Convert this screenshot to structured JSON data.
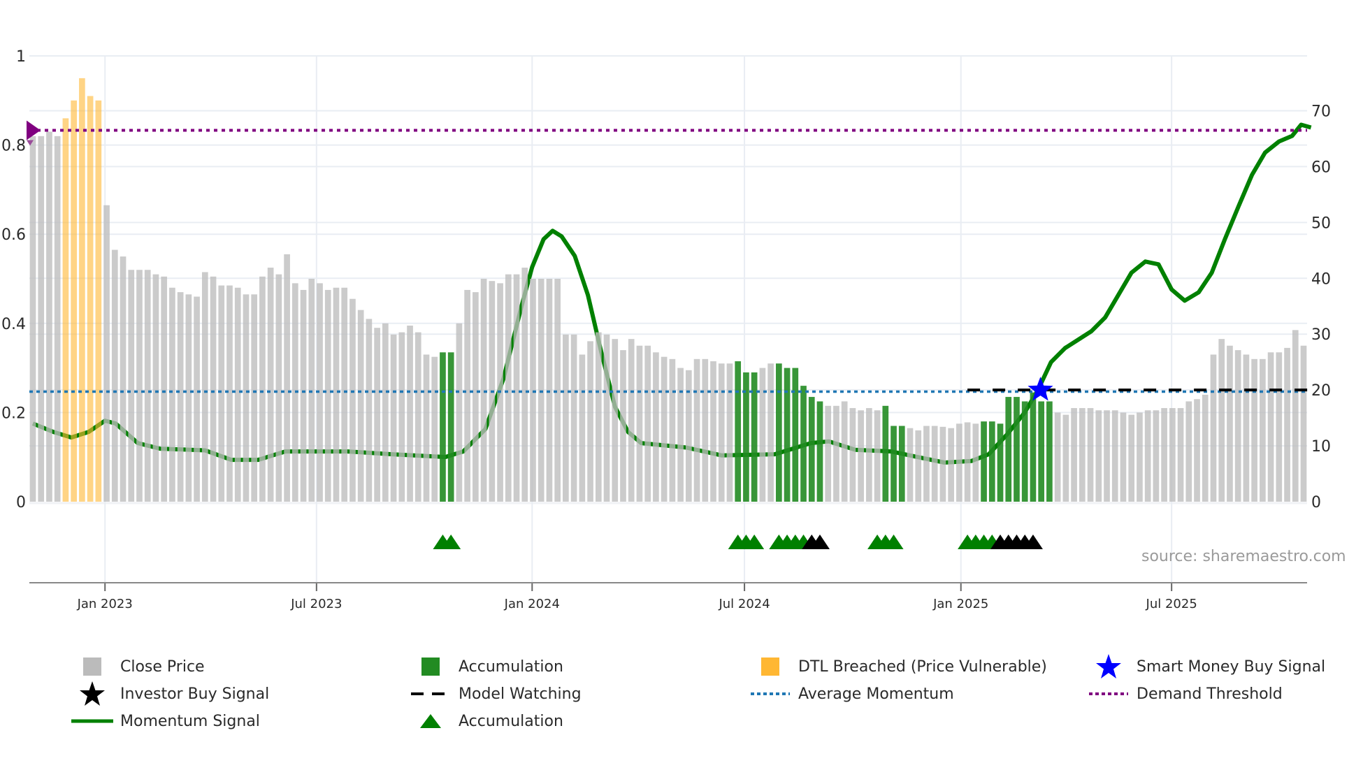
{
  "chart_data": {
    "type": "bar",
    "title": "",
    "x_index_note": "weekly bars",
    "left_axis": {
      "ticks": [
        0,
        0.2,
        0.4,
        0.6,
        0.8,
        1
      ],
      "tick_labels": [
        "0",
        "0.2",
        "0.4",
        "0.6",
        "0.8",
        "1"
      ],
      "ylim": [
        0,
        1.0
      ]
    },
    "right_axis": {
      "ticks": [
        0,
        10,
        20,
        30,
        40,
        50,
        60,
        70
      ],
      "tick_labels": [
        "0",
        "10",
        "20",
        "30",
        "40",
        "50",
        "60",
        "70"
      ],
      "ylim": [
        0,
        70
      ]
    },
    "x_ticks": [
      {
        "label": "Jan 2023",
        "index": 8.8
      },
      {
        "label": "Jul 2023",
        "index": 34.6
      },
      {
        "label": "Jan 2024",
        "index": 60.9
      },
      {
        "label": "Jul 2024",
        "index": 86.8
      },
      {
        "label": "Jan 2025",
        "index": 113.2
      },
      {
        "label": "Jul 2025",
        "index": 138.9
      }
    ],
    "grid": true,
    "close_price": [
      0.82,
      0.82,
      0.83,
      0.82,
      0.86,
      0.9,
      0.95,
      0.91,
      0.9,
      0.665,
      0.565,
      0.55,
      0.52,
      0.52,
      0.52,
      0.51,
      0.505,
      0.48,
      0.47,
      0.465,
      0.46,
      0.515,
      0.505,
      0.485,
      0.485,
      0.48,
      0.465,
      0.465,
      0.505,
      0.525,
      0.51,
      0.555,
      0.49,
      0.475,
      0.5,
      0.49,
      0.475,
      0.48,
      0.48,
      0.455,
      0.43,
      0.41,
      0.39,
      0.4,
      0.375,
      0.38,
      0.395,
      0.38,
      0.33,
      0.325,
      0.335,
      0.335,
      0.4,
      0.475,
      0.47,
      0.5,
      0.495,
      0.49,
      0.51,
      0.51,
      0.525,
      0.5,
      0.5,
      0.5,
      0.5,
      0.375,
      0.375,
      0.33,
      0.36,
      0.38,
      0.375,
      0.365,
      0.34,
      0.365,
      0.35,
      0.35,
      0.335,
      0.325,
      0.32,
      0.3,
      0.295,
      0.32,
      0.32,
      0.315,
      0.31,
      0.31,
      0.315,
      0.29,
      0.29,
      0.3,
      0.31,
      0.31,
      0.3,
      0.3,
      0.26,
      0.235,
      0.225,
      0.215,
      0.215,
      0.225,
      0.21,
      0.205,
      0.21,
      0.205,
      0.215,
      0.17,
      0.17,
      0.165,
      0.16,
      0.17,
      0.17,
      0.168,
      0.165,
      0.175,
      0.178,
      0.175,
      0.18,
      0.18,
      0.175,
      0.235,
      0.235,
      0.225,
      0.245,
      0.225,
      0.225,
      0.2,
      0.195,
      0.21,
      0.21,
      0.21,
      0.205,
      0.205,
      0.205,
      0.2,
      0.195,
      0.2,
      0.205,
      0.205,
      0.21,
      0.21,
      0.21,
      0.225,
      0.23,
      0.24,
      0.33,
      0.365,
      0.35,
      0.34,
      0.33,
      0.32,
      0.32,
      0.335,
      0.335,
      0.345,
      0.385,
      0.35
    ],
    "bar_type_codes": {
      "c": "Close Price",
      "a": "Accumulation",
      "d": "DTL Breached (Price Vulnerable)"
    },
    "bar_types": "ccccdddddcccccccccccccccccccccccccccccccccccccccccaaccccccccccccccccccccccccccccccccccaaaccaaaaaacccccccaaacccccccccaaaaaaaaacccccccccccccccccccccccccccccccccc",
    "momentum": [
      [
        0,
        14
      ],
      [
        2.5,
        12.5
      ],
      [
        4.7,
        11.5
      ],
      [
        6.8,
        12.5
      ],
      [
        8.8,
        14.5
      ],
      [
        10.1,
        14
      ],
      [
        12.8,
        10.5
      ],
      [
        15.5,
        9.5
      ],
      [
        21,
        9.2
      ],
      [
        24.2,
        7.5
      ],
      [
        27.5,
        7.5
      ],
      [
        30.8,
        9
      ],
      [
        38.4,
        9
      ],
      [
        43.8,
        8.5
      ],
      [
        50.3,
        8
      ],
      [
        52.5,
        9
      ],
      [
        55.2,
        13
      ],
      [
        57.4,
        22
      ],
      [
        59.6,
        35
      ],
      [
        60.9,
        42
      ],
      [
        62.3,
        47
      ],
      [
        63.4,
        48.5
      ],
      [
        64.5,
        47.5
      ],
      [
        66.1,
        44
      ],
      [
        67.7,
        37
      ],
      [
        69.3,
        27
      ],
      [
        71,
        17
      ],
      [
        72.6,
        12.5
      ],
      [
        74.2,
        10.5
      ],
      [
        79.7,
        9.7
      ],
      [
        84,
        8.3
      ],
      [
        90.5,
        8.5
      ],
      [
        92.7,
        9.5
      ],
      [
        94.9,
        10.5
      ],
      [
        97.1,
        10.8
      ],
      [
        100.3,
        9.3
      ],
      [
        104.7,
        9
      ],
      [
        107.9,
        8
      ],
      [
        111.2,
        7
      ],
      [
        114.5,
        7.3
      ],
      [
        116.6,
        8.5
      ],
      [
        118.8,
        12
      ],
      [
        121,
        16
      ],
      [
        122.6,
        20
      ],
      [
        124.2,
        25
      ],
      [
        125.9,
        27.5
      ],
      [
        127.5,
        29
      ],
      [
        129.1,
        30.5
      ],
      [
        130.8,
        33
      ],
      [
        132.4,
        37
      ],
      [
        134,
        41
      ],
      [
        135.7,
        43
      ],
      [
        137.3,
        42.5
      ],
      [
        138.9,
        38
      ],
      [
        140.5,
        36
      ],
      [
        142.2,
        37.5
      ],
      [
        143.8,
        41
      ],
      [
        145.4,
        47
      ],
      [
        147.1,
        53
      ],
      [
        148.7,
        58.5
      ],
      [
        150.3,
        62.5
      ],
      [
        152,
        64.5
      ],
      [
        153.6,
        65.5
      ],
      [
        154.7,
        67.5
      ],
      [
        155.9,
        67
      ]
    ],
    "average_momentum": 19.7,
    "demand_threshold": 66.5,
    "model_watching": {
      "value": 20,
      "from_index": 114,
      "to_index": 155.5
    },
    "accumulation_triangles": [
      {
        "index": 50,
        "color": "green"
      },
      {
        "index": 51,
        "color": "green"
      },
      {
        "index": 86,
        "color": "green"
      },
      {
        "index": 87,
        "color": "green"
      },
      {
        "index": 88,
        "color": "green"
      },
      {
        "index": 91,
        "color": "green"
      },
      {
        "index": 92,
        "color": "green"
      },
      {
        "index": 93,
        "color": "green"
      },
      {
        "index": 94,
        "color": "green"
      },
      {
        "index": 95,
        "color": "black"
      },
      {
        "index": 96,
        "color": "black"
      },
      {
        "index": 103,
        "color": "green"
      },
      {
        "index": 104,
        "color": "green"
      },
      {
        "index": 105,
        "color": "green"
      },
      {
        "index": 114,
        "color": "green"
      },
      {
        "index": 115,
        "color": "green"
      },
      {
        "index": 116,
        "color": "green"
      },
      {
        "index": 117,
        "color": "green"
      },
      {
        "index": 118,
        "color": "black"
      },
      {
        "index": 119,
        "color": "black"
      },
      {
        "index": 120,
        "color": "black"
      },
      {
        "index": 121,
        "color": "black"
      },
      {
        "index": 122,
        "color": "black"
      }
    ],
    "smart_money_buy_signal": {
      "index": 122.9,
      "value": 20
    },
    "threshold_marker": {
      "index": 0,
      "value": 66.5
    },
    "source_note": "source: sharemaestro.com",
    "colors": {
      "close": "#bdbdbd",
      "accumulation": "#228b22",
      "dtl": "#ffb733",
      "momentum": "#008000",
      "average": "#1f77b4",
      "demand": "#800080",
      "watching": "#000000",
      "star": "#0000ff",
      "grid": "#e9edf3"
    }
  },
  "legend": {
    "items": [
      {
        "label": "Close Price",
        "icon": "square-gray"
      },
      {
        "label": "Accumulation",
        "icon": "square-green"
      },
      {
        "label": "DTL Breached (Price Vulnerable)",
        "icon": "square-orange"
      },
      {
        "label": "Smart Money Buy Signal",
        "icon": "star-blue"
      },
      {
        "label": "Investor Buy Signal",
        "icon": "star-black"
      },
      {
        "label": "Model Watching",
        "icon": "dash-black"
      },
      {
        "label": "Average Momentum",
        "icon": "dotted-blue"
      },
      {
        "label": "Demand Threshold",
        "icon": "dotted-purple"
      },
      {
        "label": "Momentum Signal",
        "icon": "line-green"
      },
      {
        "label": "Accumulation",
        "icon": "triangle-green"
      }
    ]
  }
}
